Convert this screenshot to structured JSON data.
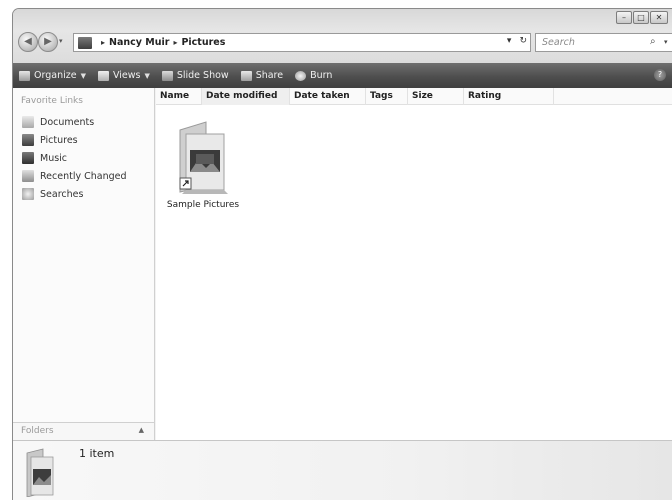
{
  "window": {
    "controls": {
      "minimize_glyph": "–",
      "maximize_glyph": "□",
      "close_glyph": "✕"
    }
  },
  "navigation": {
    "back_glyph": "◀",
    "forward_glyph": "▶",
    "dropdown_glyph": "▾"
  },
  "address": {
    "separator": "▸",
    "crumbs": [
      "Nancy Muir",
      "Pictures"
    ],
    "dropdown_glyph": "▾",
    "refresh_glyph": "↻"
  },
  "search": {
    "placeholder": "Search",
    "icon_glyph": "⌕",
    "dropdown_glyph": "▾"
  },
  "toolbar": {
    "items": [
      {
        "label": "Organize",
        "icon": "organize-icon",
        "has_dropdown": true
      },
      {
        "label": "Views",
        "icon": "views-icon",
        "has_dropdown": true
      },
      {
        "label": "Slide Show",
        "icon": "slideshow-icon",
        "has_dropdown": false
      },
      {
        "label": "Share",
        "icon": "share-icon",
        "has_dropdown": false
      },
      {
        "label": "Burn",
        "icon": "burn-icon",
        "has_dropdown": false
      }
    ],
    "dropdown_glyph": "▼",
    "help_glyph": "?"
  },
  "nav_pane": {
    "header": "Favorite Links",
    "items": [
      {
        "label": "Documents",
        "icon": "documents-icon"
      },
      {
        "label": "Pictures",
        "icon": "pictures-icon"
      },
      {
        "label": "Music",
        "icon": "music-icon"
      },
      {
        "label": "Recently Changed",
        "icon": "recently-changed-icon"
      },
      {
        "label": "Searches",
        "icon": "searches-icon"
      }
    ],
    "folders_label": "Folders",
    "folders_caret": "▲"
  },
  "columns": [
    "Name",
    "Date modified",
    "Date taken",
    "Tags",
    "Size",
    "Rating"
  ],
  "files": [
    {
      "name": "Sample Pictures",
      "icon": "folder-shortcut-icon"
    }
  ],
  "details": {
    "item_count": "1 item"
  }
}
